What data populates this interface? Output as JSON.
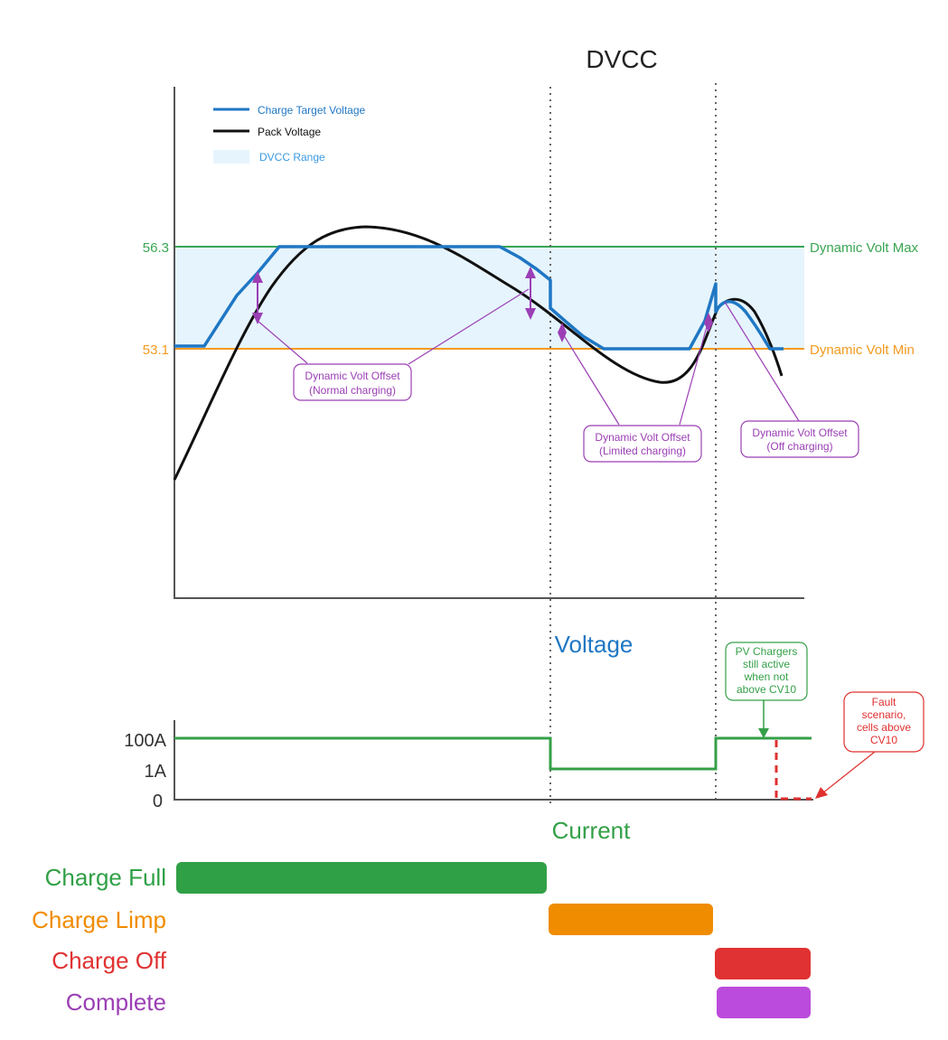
{
  "title": "DVCC",
  "colors": {
    "target": "#1f77c4",
    "pack": "#111111",
    "range_fill": "#e6f4fd",
    "max": "#3aa552",
    "min": "#f39a1e",
    "offset": "#9b3fb5",
    "current": "#34a048",
    "fault": "#e03030",
    "axis": "#555555",
    "divider": "#666666",
    "bar_full": "#30a046",
    "bar_limp": "#f08c00",
    "bar_off": "#e03232",
    "bar_complete": "#bb4bdc"
  },
  "legend": {
    "target": "Charge Target Voltage",
    "pack": "Pack Voltage",
    "range": "DVCC Range"
  },
  "voltage_chart": {
    "axis_title": "Voltage",
    "max_value": "56.3",
    "min_value": "53.1",
    "max_label": "Dynamic Volt Max",
    "min_label": "Dynamic Volt Min",
    "annotations": [
      {
        "line1": "Dynamic Volt Offset",
        "line2": "(Normal charging)"
      },
      {
        "line1": "Dynamic Volt Offset",
        "line2": "(Limited charging)"
      },
      {
        "line1": "Dynamic Volt Offset",
        "line2": "(Off charging)"
      }
    ]
  },
  "current_chart": {
    "axis_title": "Current",
    "ticks": [
      "100A",
      "1A",
      "0"
    ],
    "note_pv": [
      "PV Chargers",
      "still active",
      "when not",
      "above CV10"
    ],
    "note_fault": [
      "Fault",
      "scenario,",
      "cells above",
      "CV10"
    ]
  },
  "states": [
    {
      "label": "Charge Full",
      "color": "#30a046"
    },
    {
      "label": "Charge Limp",
      "color": "#f08c00"
    },
    {
      "label": "Charge Off",
      "color": "#e03232"
    },
    {
      "label": "Complete",
      "color": "#bb4bdc"
    }
  ]
}
